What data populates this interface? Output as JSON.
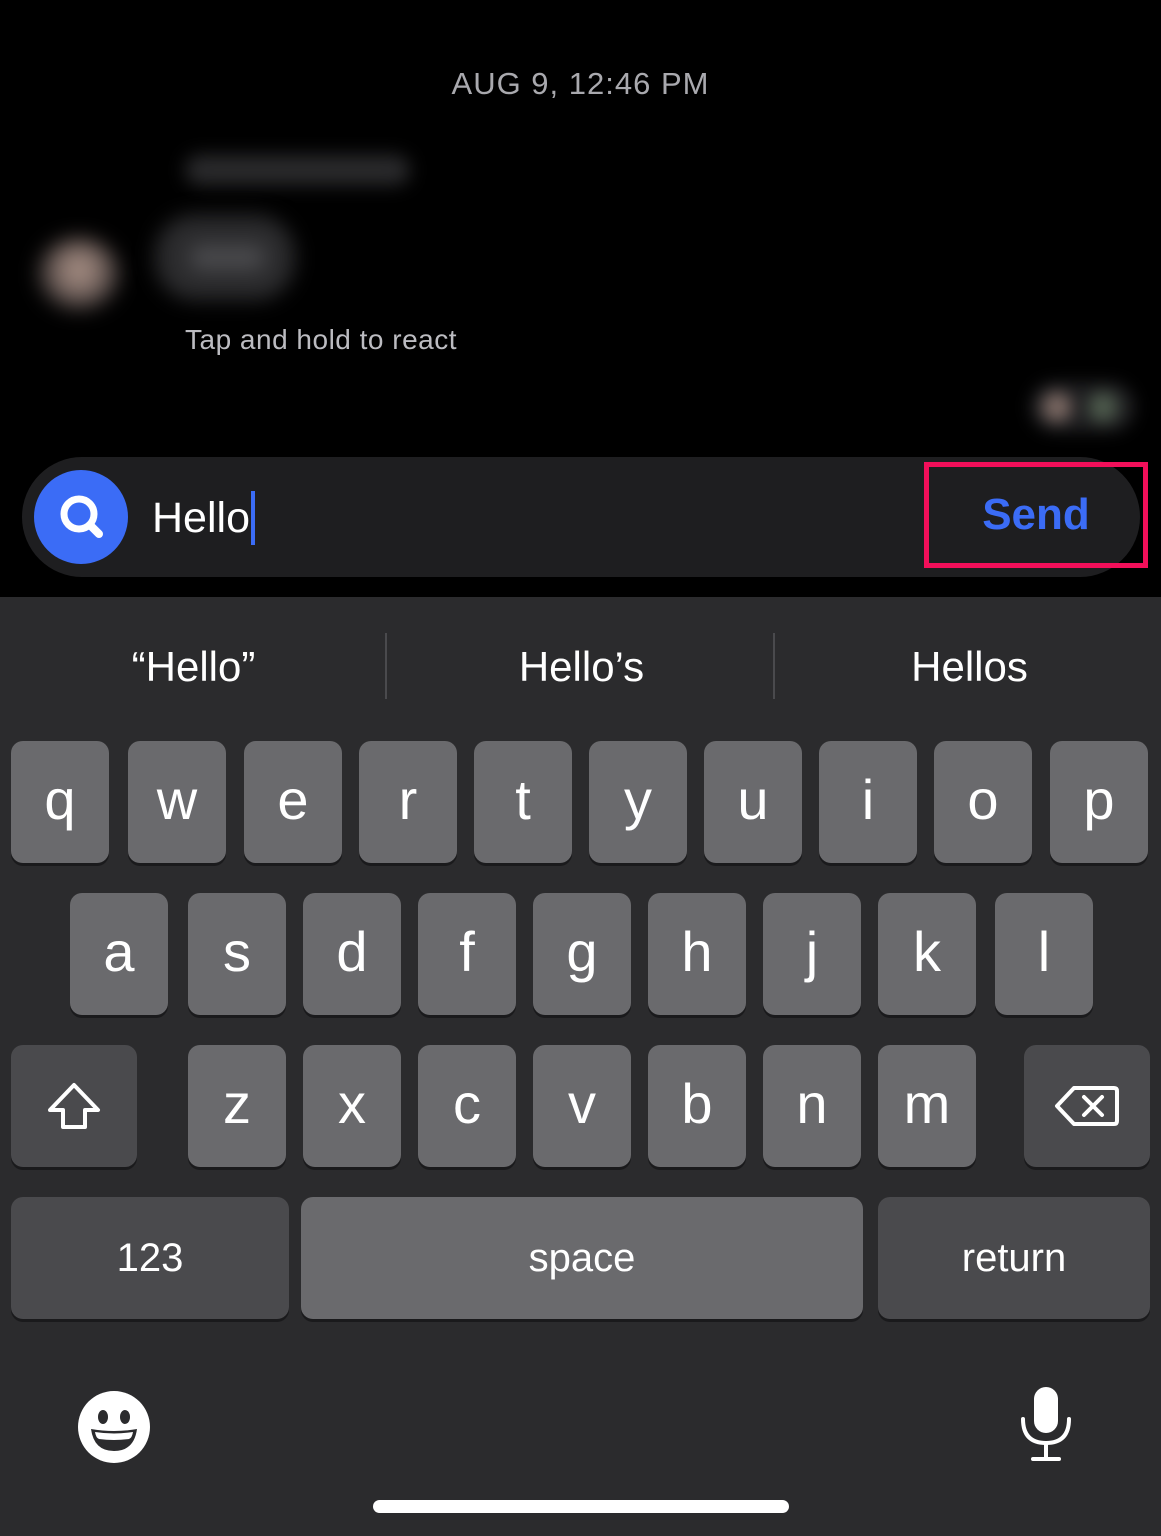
{
  "chat": {
    "timestamp": "AUG 9, 12:46 PM",
    "hint": "Tap and hold to react"
  },
  "composer": {
    "input_value": "Hello",
    "send_label": "Send",
    "accent_color": "#3b6cf6",
    "highlight_color": "#f20f5a",
    "search_icon": "search-icon"
  },
  "keyboard": {
    "suggestions": [
      "“Hello”",
      "Hello’s",
      "Hellos"
    ],
    "row1": [
      "q",
      "w",
      "e",
      "r",
      "t",
      "y",
      "u",
      "i",
      "o",
      "p"
    ],
    "row2": [
      "a",
      "s",
      "d",
      "f",
      "g",
      "h",
      "j",
      "k",
      "l"
    ],
    "row3": [
      "z",
      "x",
      "c",
      "v",
      "b",
      "n",
      "m"
    ],
    "numbers_label": "123",
    "space_label": "space",
    "return_label": "return",
    "icons": [
      "shift-icon",
      "backspace-icon",
      "emoji-icon",
      "microphone-icon"
    ]
  }
}
